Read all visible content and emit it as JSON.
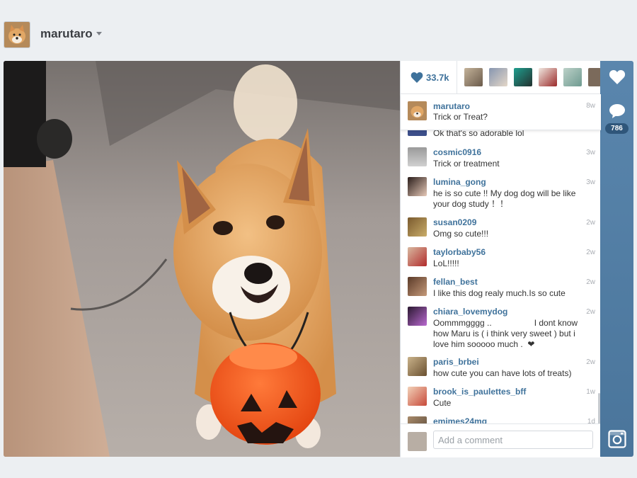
{
  "header": {
    "username": "marutaro"
  },
  "likes": {
    "count": "33.7k"
  },
  "caption": {
    "username": "marutaro",
    "time": "8w",
    "text": "Trick or Treat?"
  },
  "partial_top_comment": {
    "text": "Ok that's so adorable lol"
  },
  "comments": [
    {
      "username": "cosmic0916",
      "time": "3w",
      "text": "Trick or treatment"
    },
    {
      "username": "lumina_gong",
      "time": "3w",
      "text": "he is so cute !! My dog dog will be like your dog study ！！"
    },
    {
      "username": "susan0209",
      "time": "2w",
      "text": "Omg so cute!!!"
    },
    {
      "username": "taylorbaby56",
      "time": "2w",
      "text": "LoL!!!!!"
    },
    {
      "username": "fellan_best",
      "time": "2w",
      "text": "I like this dog realy much.Is so cute"
    },
    {
      "username": "chiara_lovemydog",
      "time": "2w",
      "text": "Oommmgggg ..                  I dont know how Maru is ( i think very sweet ) but i love him sooooo much .  ❤"
    },
    {
      "username": "paris_brbei",
      "time": "2w",
      "text": "how cute you can have lots of treats)"
    },
    {
      "username": "brook_is_paulettes_bff",
      "time": "1w",
      "text": "Cute"
    },
    {
      "username": "emimes24mg",
      "time": "1d",
      "text": ""
    }
  ],
  "comment_box": {
    "placeholder": "Add a comment"
  },
  "sidebar": {
    "comment_count": "786"
  },
  "colors": {
    "link_blue": "#3f729b",
    "sidebar_blue": "#517fa4",
    "pumpkin": "#f2571b"
  },
  "icons": [
    "heart-icon",
    "comment-bubble-icon",
    "instagram-camera-icon",
    "caret-down-icon"
  ]
}
